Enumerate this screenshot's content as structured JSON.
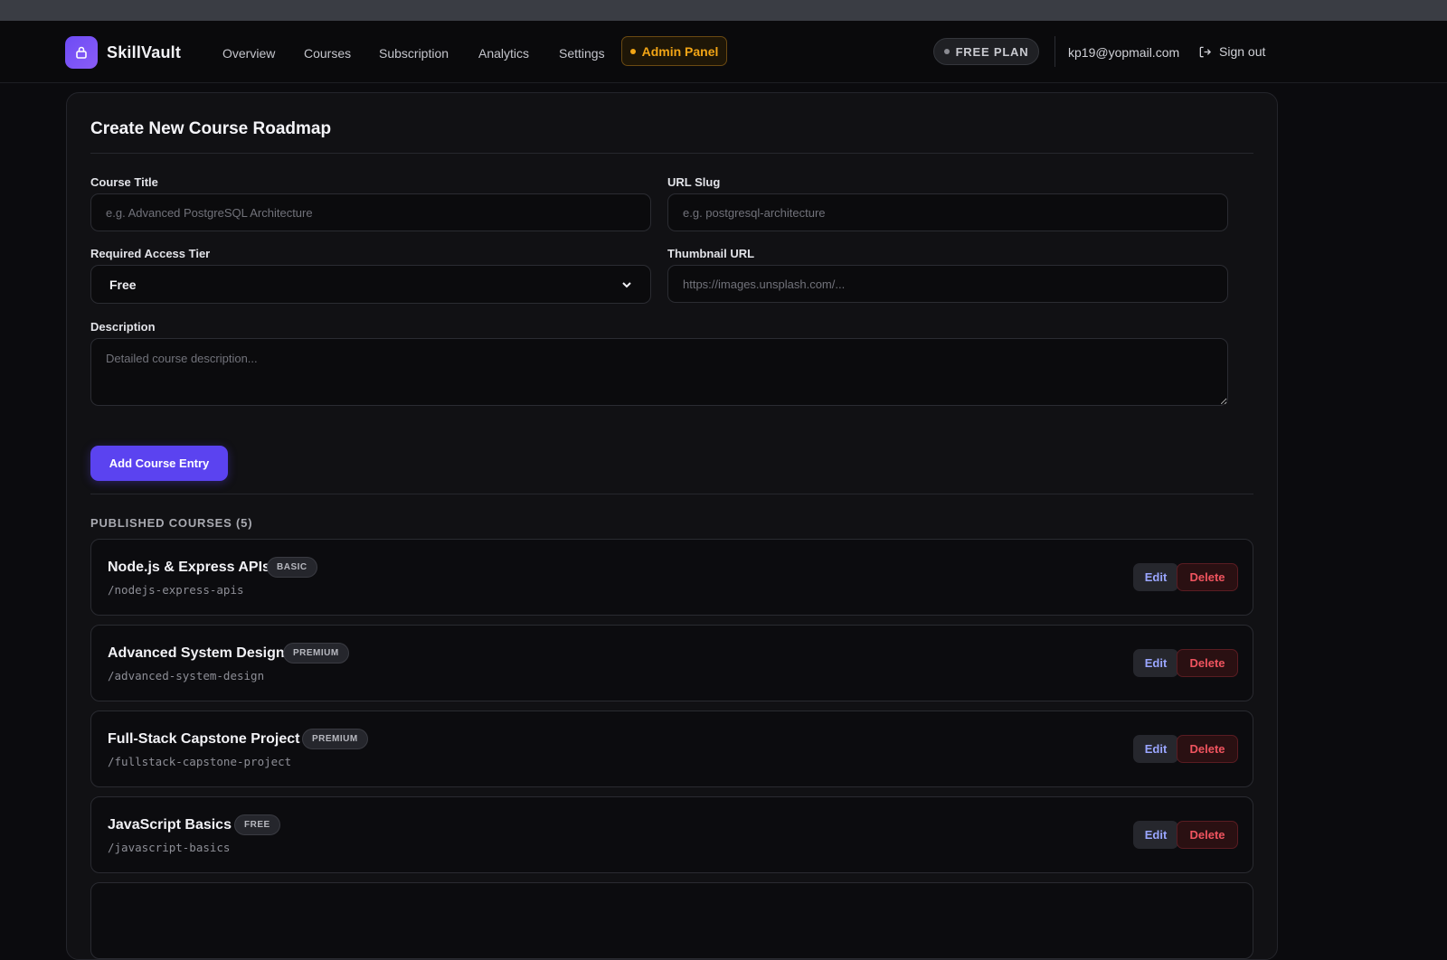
{
  "app": {
    "brand": "SkillVault"
  },
  "nav": {
    "items": [
      {
        "label": "Overview"
      },
      {
        "label": "Courses"
      },
      {
        "label": "Subscription"
      },
      {
        "label": "Analytics"
      },
      {
        "label": "Settings"
      }
    ],
    "admin_label": "Admin Panel",
    "plan_label": "FREE PLAN",
    "email": "kp19@yopmail.com",
    "signout_label": "Sign out"
  },
  "form": {
    "title": "Create New Course Roadmap",
    "course_title_label": "Course Title",
    "course_title_placeholder": "e.g. Advanced PostgreSQL Architecture",
    "course_title_value": "",
    "slug_label": "URL Slug",
    "slug_placeholder": "e.g. postgresql-architecture",
    "slug_value": "",
    "tier_label": "Required Access Tier",
    "tier_value": "Free",
    "thumbnail_label": "Thumbnail URL",
    "thumbnail_placeholder": "https://images.unsplash.com/...",
    "thumbnail_value": "",
    "description_label": "Description",
    "description_placeholder": "Detailed course description...",
    "description_value": "",
    "submit_label": "Add Course Entry"
  },
  "published": {
    "heading": "PUBLISHED COURSES (5)",
    "edit_label": "Edit",
    "delete_label": "Delete",
    "courses": [
      {
        "name": "Node.js & Express APIs",
        "tier": "BASIC",
        "slug": "/nodejs-express-apis"
      },
      {
        "name": "Advanced System Design",
        "tier": "PREMIUM",
        "slug": "/advanced-system-design"
      },
      {
        "name": "Full-Stack Capstone Project",
        "tier": "PREMIUM",
        "slug": "/fullstack-capstone-project"
      },
      {
        "name": "JavaScript Basics",
        "tier": "FREE",
        "slug": "/javascript-basics"
      }
    ]
  },
  "colors": {
    "accent": "#5b43f0",
    "admin": "#f2a516",
    "danger": "#f0545f",
    "background": "#0b0b0e"
  }
}
